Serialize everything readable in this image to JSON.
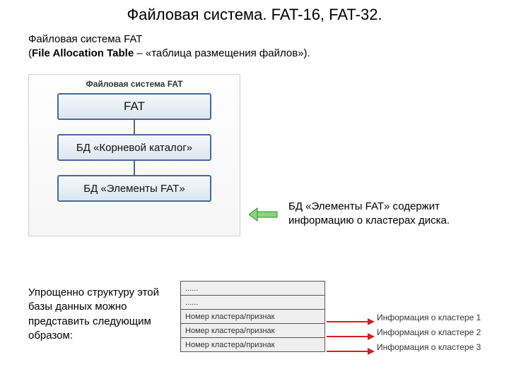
{
  "title": "Файловая система. FAT-16, FAT-32.",
  "intro_line1": "Файловая система FAT",
  "intro_bold": "File Allocation Table",
  "intro_rest": " – «таблица размещения файлов»).",
  "diagram": {
    "header": "Файловая система FAT",
    "boxes": [
      "FAT",
      "БД «Корневой каталог»",
      "БД «Элементы FAT»"
    ]
  },
  "side_text": "БД «Элементы FAT» содержит информацию о кластерах диска.",
  "bottom_left": "Упрощенно структуру этой базы данных можно представить следующим образом:",
  "struct_rows": [
    "......",
    "......",
    "Номер кластера/признак",
    "Номер кластера/признак",
    "Номер кластера/признак"
  ],
  "info_rows": [
    "Информация о кластере 1",
    "Информация о кластере 2",
    "Информация о кластере 3"
  ]
}
